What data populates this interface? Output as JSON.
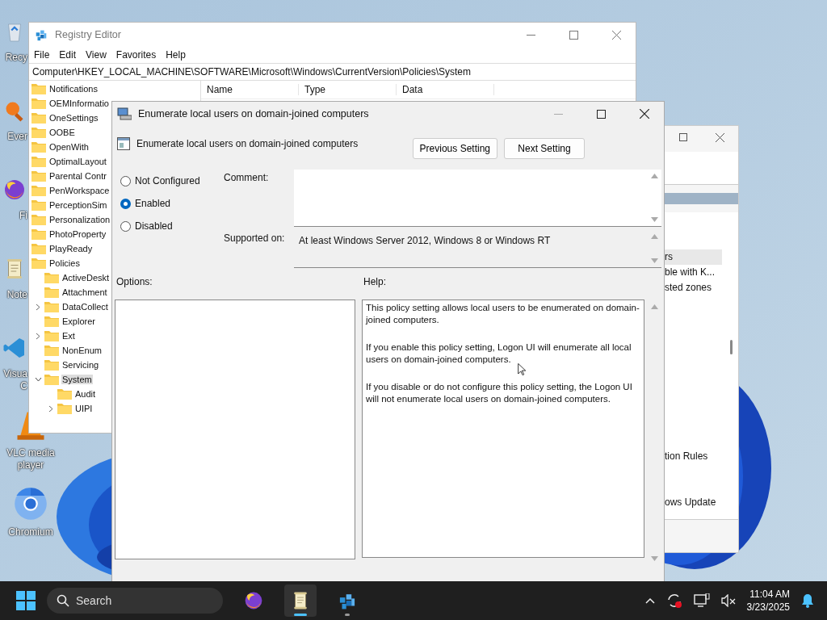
{
  "desktop": {
    "icons": [
      {
        "kind": "recycle",
        "lines": [
          "Recy"
        ]
      },
      {
        "kind": "search-app",
        "lines": [
          "Ever"
        ]
      },
      {
        "kind": "fox",
        "lines": [
          "Fi"
        ]
      },
      {
        "kind": "notepad",
        "lines": [
          "Note"
        ]
      },
      {
        "kind": "code",
        "lines": [
          "Visua",
          "C"
        ]
      },
      {
        "kind": "cone",
        "lines": [
          "VLC media",
          "player"
        ]
      },
      {
        "kind": "chromium",
        "lines": [
          "Chromium"
        ]
      }
    ]
  },
  "registry_editor": {
    "title": "Registry Editor",
    "menu": [
      "File",
      "Edit",
      "View",
      "Favorites",
      "Help"
    ],
    "address": "Computer\\HKEY_LOCAL_MACHINE\\SOFTWARE\\Microsoft\\Windows\\CurrentVersion\\Policies\\System",
    "tree": [
      {
        "label": "Notifications",
        "selected": false
      },
      {
        "label": "OEMInformatio",
        "selected": false
      },
      {
        "label": "OneSettings",
        "selected": false
      },
      {
        "label": "OOBE",
        "selected": false
      },
      {
        "label": "OpenWith",
        "selected": false
      },
      {
        "label": "OptimalLayout",
        "selected": false
      },
      {
        "label": "Parental Contr",
        "selected": false
      },
      {
        "label": "PenWorkspace",
        "selected": false
      },
      {
        "label": "PerceptionSim",
        "selected": false
      },
      {
        "label": "Personalization",
        "selected": false
      },
      {
        "label": "PhotoProperty",
        "selected": false
      },
      {
        "label": "PlayReady",
        "selected": false
      },
      {
        "label": "Policies",
        "selected": false,
        "children": [
          {
            "label": "ActiveDeskt",
            "kind": "leaf",
            "selected": false
          },
          {
            "label": "Attachment",
            "kind": "leaf",
            "selected": false
          },
          {
            "label": "DataCollect",
            "kind": "collapsed",
            "selected": false
          },
          {
            "label": "Explorer",
            "kind": "leaf",
            "selected": false
          },
          {
            "label": "Ext",
            "kind": "collapsed",
            "selected": false
          },
          {
            "label": "NonEnum",
            "kind": "leaf",
            "selected": false
          },
          {
            "label": "Servicing",
            "kind": "leaf",
            "selected": false
          },
          {
            "label": "System",
            "kind": "expanded",
            "selected": true,
            "children": [
              {
                "label": "Audit",
                "kind": "leaf",
                "selected": false
              },
              {
                "label": "UIPI",
                "kind": "collapsed",
                "selected": false
              }
            ]
          }
        ]
      }
    ],
    "columns": [
      "Name",
      "Type",
      "Data"
    ]
  },
  "background_window": {
    "items": [
      {
        "label": "rs",
        "selected": true
      },
      {
        "label": "ble with K...",
        "selected": false
      },
      {
        "label": "sted zones",
        "selected": false
      },
      {
        "label": "tion Rules",
        "selected": false
      },
      {
        "label": "ows Update",
        "selected": false
      }
    ]
  },
  "policy_dialog": {
    "title": "Enumerate local users on domain-joined computers",
    "setting_name": "Enumerate local users on domain-joined computers",
    "buttons": [
      "Previous Setting",
      "Next Setting"
    ],
    "options": [
      {
        "label": "Not Configured",
        "selected": false
      },
      {
        "label": "Enabled",
        "selected": true
      },
      {
        "label": "Disabled",
        "selected": false
      }
    ],
    "comment_label": "Comment:",
    "supported_label": "Supported on:",
    "supported_value": "At least Windows Server 2012, Windows 8 or Windows RT",
    "options_label": "Options:",
    "help_label": "Help:",
    "help": [
      "This policy setting allows local users to be enumerated on domain-joined computers.",
      "If you enable this policy setting, Logon UI will enumerate all local users on domain-joined computers.",
      "If you disable or do not configure this policy setting, the Logon UI will not enumerate local users on domain-joined computers."
    ]
  },
  "taskbar": {
    "search": {
      "placeholder": "Search"
    },
    "apps": [
      {
        "kind": "fox",
        "active": false,
        "running": false
      },
      {
        "kind": "notepad",
        "active": true,
        "running": true
      },
      {
        "kind": "registry",
        "active": false,
        "running": true
      }
    ],
    "time": "11:04 AM",
    "date": "3/23/2025"
  }
}
